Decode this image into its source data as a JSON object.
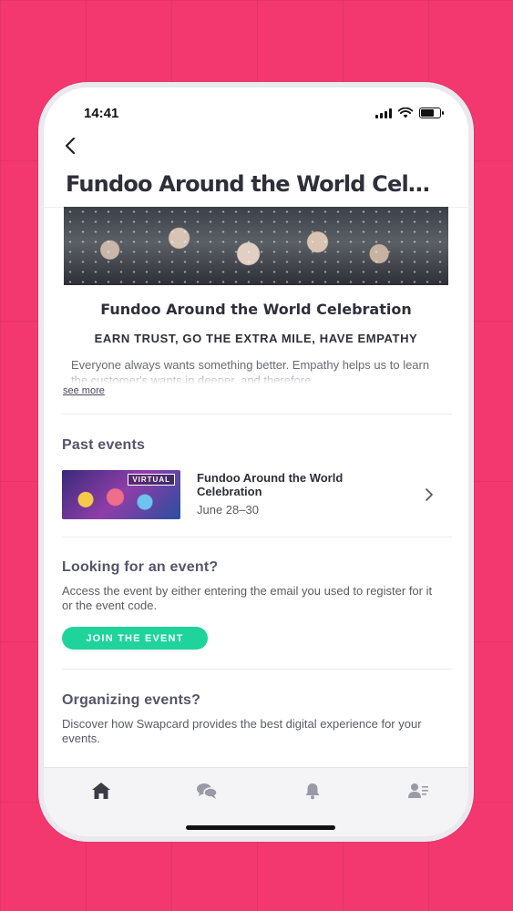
{
  "status_bar": {
    "time": "14:41"
  },
  "header": {
    "title": "Fundoo Around the World Cel…"
  },
  "event": {
    "name": "Fundoo Around the World Celebration",
    "tagline": "EARN TRUST, GO THE EXTRA MILE, HAVE EMPATHY",
    "description": "Everyone always wants something better. Empathy helps us to learn the customer's wants in deeper, and therefore",
    "see_more_label": "see more"
  },
  "past_events": {
    "section_title": "Past events",
    "items": [
      {
        "badge": "VIRTUAL",
        "title": "Fundoo Around the World Celebration",
        "date": "June 28–30"
      }
    ]
  },
  "looking": {
    "section_title": "Looking for an event?",
    "description": "Access the event by either entering the email you used to register for it or the event code.",
    "button_label": "JOIN THE EVENT"
  },
  "organizing": {
    "section_title": "Organizing events?",
    "description": "Discover how Swapcard provides the best digital experience for your events."
  },
  "tab_bar": {
    "items": [
      {
        "icon": "home-icon",
        "active": true
      },
      {
        "icon": "chat-icon",
        "active": false
      },
      {
        "icon": "bell-icon",
        "active": false
      },
      {
        "icon": "contacts-icon",
        "active": false
      }
    ]
  },
  "colors": {
    "background": "#f2386e",
    "accent_button": "#1ed49b",
    "text_dark": "#2f2f3a",
    "text_muted": "#5a5a66"
  }
}
